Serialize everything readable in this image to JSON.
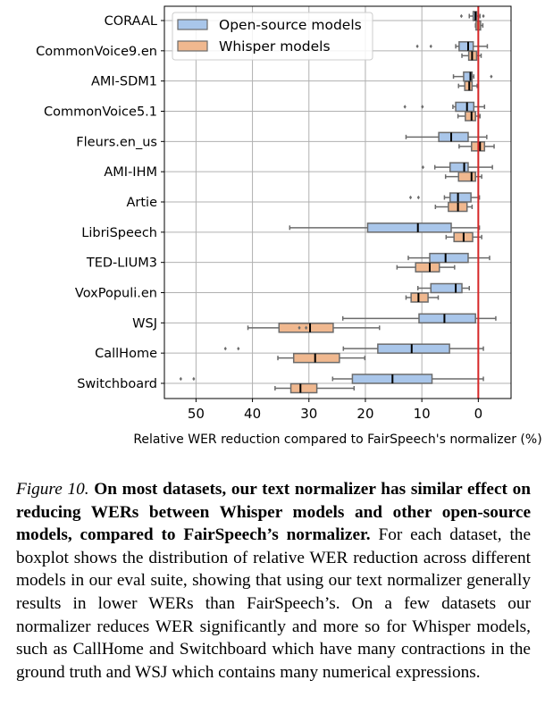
{
  "chart_data": {
    "type": "boxplot-horizontal",
    "title": "",
    "xlabel": "Relative WER reduction compared to FairSpeech's normalizer (%)",
    "ylabel": "",
    "xlim": [
      55.6,
      -5.8
    ],
    "x_inverted": true,
    "xticks": [
      50,
      40,
      30,
      20,
      10,
      0
    ],
    "grid": true,
    "reference_line": {
      "x": 0,
      "color": "#d62728"
    },
    "legend": {
      "placement": "top-left",
      "entries": [
        "Open-source models",
        "Whisper models"
      ]
    },
    "colors": {
      "Open-source models": "#a9c6ea",
      "Whisper models": "#f0b88f"
    },
    "categories": [
      "CORAAL",
      "CommonVoice9.en",
      "AMI-SDM1",
      "CommonVoice5.1",
      "Fleurs.en_us",
      "AMI-IHM",
      "Artie",
      "LibriSpeech",
      "TED-LIUM3",
      "VoxPopuli.en",
      "WSJ",
      "CallHome",
      "Switchboard"
    ],
    "series": [
      {
        "name": "Open-source models",
        "boxes": [
          {
            "whisker_high": 1.6,
            "q3": 0.9,
            "median": 0.5,
            "q1": 0.3,
            "whisker_low": -0.3,
            "outliers": [
              3.0,
              -0.9
            ]
          },
          {
            "whisker_high": 4.0,
            "q3": 3.4,
            "median": 1.8,
            "q1": 0.9,
            "whisker_low": -1.6,
            "outliers": [
              10.8,
              8.4
            ]
          },
          {
            "whisker_high": 4.4,
            "q3": 2.6,
            "median": 1.4,
            "q1": 1.1,
            "whisker_low": 0.8,
            "outliers": [
              -2.3
            ]
          },
          {
            "whisker_high": 4.5,
            "q3": 4.0,
            "median": 2.0,
            "q1": 0.8,
            "whisker_low": -1.1,
            "outliers": [
              13.0,
              9.9
            ]
          },
          {
            "whisker_high": 12.8,
            "q3": 7.0,
            "median": 4.8,
            "q1": 1.8,
            "whisker_low": -1.5,
            "outliers": []
          },
          {
            "whisker_high": 7.7,
            "q3": 5.0,
            "median": 2.5,
            "q1": 1.8,
            "whisker_low": -2.5,
            "outliers": [
              9.8
            ]
          },
          {
            "whisker_high": 6.0,
            "q3": 5.0,
            "median": 3.6,
            "q1": 1.3,
            "whisker_low": -0.2,
            "outliers": [
              12.0,
              10.6
            ]
          },
          {
            "whisker_high": 33.4,
            "q3": 19.6,
            "median": 10.7,
            "q1": 4.8,
            "whisker_low": -0.2,
            "outliers": []
          },
          {
            "whisker_high": 12.4,
            "q3": 8.6,
            "median": 5.8,
            "q1": 1.8,
            "whisker_low": -2.0,
            "outliers": []
          },
          {
            "whisker_high": 10.7,
            "q3": 8.4,
            "median": 4.0,
            "q1": 2.9,
            "whisker_low": 1.6,
            "outliers": []
          },
          {
            "whisker_high": 24.0,
            "q3": 10.5,
            "median": 6.0,
            "q1": 0.5,
            "whisker_low": -3.1,
            "outliers": []
          },
          {
            "whisker_high": 23.9,
            "q3": 17.8,
            "median": 11.8,
            "q1": 5.1,
            "whisker_low": -0.9,
            "outliers": [
              44.8,
              42.5
            ]
          },
          {
            "whisker_high": 25.8,
            "q3": 22.3,
            "median": 15.2,
            "q1": 8.2,
            "whisker_low": -0.9,
            "outliers": [
              52.7,
              50.4
            ]
          }
        ]
      },
      {
        "name": "Whisper models",
        "boxes": [
          {
            "whisker_high": 0.5,
            "q3": 0.4,
            "median": 0.0,
            "q1": -0.4,
            "whisker_low": -0.8,
            "outliers": []
          },
          {
            "whisker_high": 2.9,
            "q3": 1.7,
            "median": 1.1,
            "q1": 0.3,
            "whisker_low": -0.5,
            "outliers": []
          },
          {
            "whisker_high": 3.5,
            "q3": 2.4,
            "median": 1.6,
            "q1": 1.1,
            "whisker_low": 0.2,
            "outliers": []
          },
          {
            "whisker_high": 3.6,
            "q3": 2.3,
            "median": 1.2,
            "q1": 0.5,
            "whisker_low": -0.3,
            "outliers": []
          },
          {
            "whisker_high": 3.4,
            "q3": 1.2,
            "median": -0.3,
            "q1": -1.1,
            "whisker_low": -2.8,
            "outliers": []
          },
          {
            "whisker_high": 5.8,
            "q3": 3.5,
            "median": 1.2,
            "q1": 0.5,
            "whisker_low": -0.6,
            "outliers": []
          },
          {
            "whisker_high": 7.6,
            "q3": 5.3,
            "median": 3.6,
            "q1": 2.0,
            "whisker_low": 1.1,
            "outliers": []
          },
          {
            "whisker_high": 5.7,
            "q3": 4.3,
            "median": 2.6,
            "q1": 1.0,
            "whisker_low": -0.6,
            "outliers": []
          },
          {
            "whisker_high": 14.4,
            "q3": 11.1,
            "median": 8.6,
            "q1": 6.9,
            "whisker_low": 4.2,
            "outliers": []
          },
          {
            "whisker_high": 12.8,
            "q3": 11.9,
            "median": 10.6,
            "q1": 8.9,
            "whisker_low": 7.1,
            "outliers": []
          },
          {
            "whisker_high": 40.8,
            "q3": 35.3,
            "median": 29.8,
            "q1": 25.7,
            "whisker_low": 17.5,
            "outliers": [
              31.7,
              30.5
            ]
          },
          {
            "whisker_high": 35.5,
            "q3": 32.7,
            "median": 28.9,
            "q1": 24.6,
            "whisker_low": 20.1,
            "outliers": []
          },
          {
            "whisker_high": 36.0,
            "q3": 33.2,
            "median": 31.5,
            "q1": 28.6,
            "whisker_low": 22.0,
            "outliers": []
          }
        ]
      }
    ]
  },
  "caption": {
    "figure_label": "Figure 10.",
    "bold_text": "On most datasets, our text normalizer has similar effect on reducing WERs between Whisper models and other open-source models, compared to FairSpeech’s normalizer.",
    "body_text": "For each dataset, the boxplot shows the distribution of relative WER reduction across different models in our eval suite, showing that using our text normalizer generally results in lower WERs than FairSpeech’s. On a few datasets our normalizer reduces WER significantly and more so for Whisper models, such as CallHome and Switchboard which have many contractions in the ground truth and WSJ which contains many numerical expressions."
  }
}
